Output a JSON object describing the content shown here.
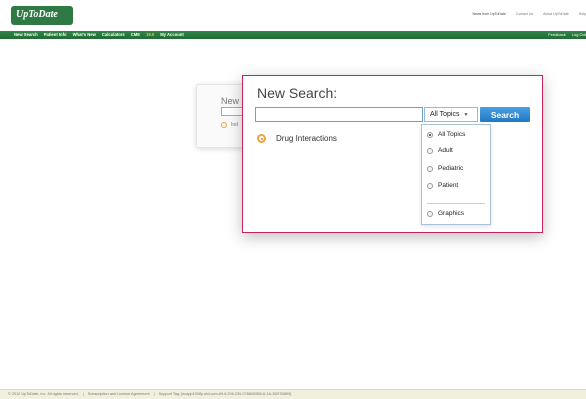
{
  "header": {
    "logo_text": "UpToDate",
    "util_links": [
      "News from UpToDate",
      "Contact Us",
      "About UpToDate",
      "Help"
    ]
  },
  "nav": {
    "tabs": [
      "New Search",
      "Patient Info",
      "What's New",
      "Calculators",
      "CME",
      "19.0",
      "My Account"
    ],
    "right_links": [
      "Feedback",
      "Log Out"
    ]
  },
  "background_panel": {
    "title": "New",
    "link_text": "Ind"
  },
  "search_panel": {
    "title": "New Search:",
    "input_value": "",
    "selected_topic": "All Topics",
    "search_button": "Search",
    "drug_link": "Drug Interactions"
  },
  "topic_dropdown": {
    "options": [
      {
        "label": "All Topics",
        "selected": true
      },
      {
        "label": "Adult",
        "selected": false
      },
      {
        "label": "Pediatric",
        "selected": false
      },
      {
        "label": "Patient",
        "selected": false
      },
      {
        "label": "Graphics",
        "selected": false
      }
    ]
  },
  "footer": {
    "items": [
      "© 2012 UpToDate, Inc. All rights reserved.",
      "Subscription and License Agreement",
      "Support Tag: [ecapp1008p.utd.com-69.6.206.239-0788059B5-6-1A-3D97B899]"
    ]
  },
  "colors": {
    "brand_green": "#2e8747",
    "popup_border": "#c7245c",
    "search_blue": "#1f78c4",
    "bullet_orange": "#f0a23c"
  }
}
